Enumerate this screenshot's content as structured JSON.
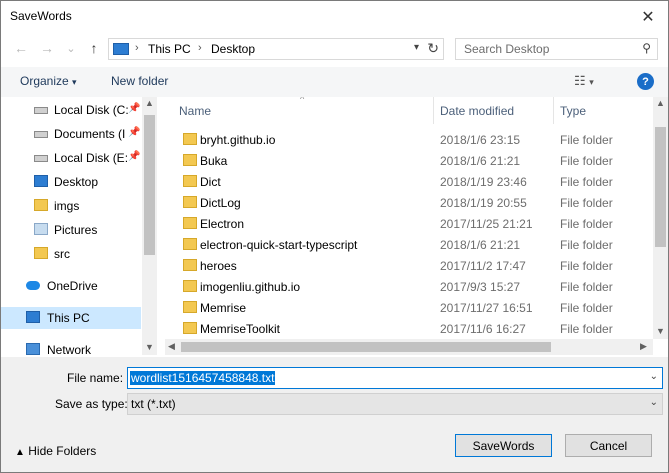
{
  "window": {
    "title": "SaveWords",
    "close_glyph": "✕"
  },
  "nav": {
    "back_glyph": "←",
    "forward_glyph": "→",
    "recent_glyph": "⌄",
    "up_glyph": "↑",
    "breadcrumb": [
      "This PC",
      "Desktop"
    ],
    "search_placeholder": "Search Desktop"
  },
  "toolbar": {
    "organize": "Organize",
    "new_folder": "New folder",
    "help": "?"
  },
  "sidebar": {
    "items": [
      {
        "label": "Local Disk (C:",
        "icon": "disk-icon",
        "pinned": true
      },
      {
        "label": "Documents (I",
        "icon": "disk-icon",
        "pinned": true
      },
      {
        "label": "Local Disk (E:",
        "icon": "disk-icon",
        "pinned": true
      },
      {
        "label": "Desktop",
        "icon": "desktop-icon",
        "pinned": false
      },
      {
        "label": "imgs",
        "icon": "folder-icon",
        "pinned": false
      },
      {
        "label": "Pictures",
        "icon": "pictures-icon",
        "pinned": false
      },
      {
        "label": "src",
        "icon": "folder-icon",
        "pinned": false
      }
    ],
    "onedrive": "OneDrive",
    "this_pc": "This PC",
    "network": "Network"
  },
  "columns": {
    "name": "Name",
    "date": "Date modified",
    "type": "Type"
  },
  "files": [
    {
      "name": "bryht.github.io",
      "date": "2018/1/6 23:15",
      "type": "File folder"
    },
    {
      "name": "Buka",
      "date": "2018/1/6 21:21",
      "type": "File folder"
    },
    {
      "name": "Dict",
      "date": "2018/1/19 23:46",
      "type": "File folder"
    },
    {
      "name": "DictLog",
      "date": "2018/1/19 20:55",
      "type": "File folder"
    },
    {
      "name": "Electron",
      "date": "2017/11/25 21:21",
      "type": "File folder"
    },
    {
      "name": "electron-quick-start-typescript",
      "date": "2018/1/6 21:21",
      "type": "File folder"
    },
    {
      "name": "heroes",
      "date": "2017/11/2 17:47",
      "type": "File folder"
    },
    {
      "name": "imogenliu.github.io",
      "date": "2017/9/3 15:27",
      "type": "File folder"
    },
    {
      "name": "Memrise",
      "date": "2017/11/27 16:51",
      "type": "File folder"
    },
    {
      "name": "MemriseToolkit",
      "date": "2017/11/6 16:27",
      "type": "File folder"
    }
  ],
  "form": {
    "file_name_label": "File name:",
    "file_name_value": "wordlist1516457458848.txt",
    "save_type_label": "Save as type:",
    "save_type_value": "txt (*.txt)"
  },
  "footer": {
    "hide_folders": "Hide Folders",
    "save_button": "SaveWords",
    "cancel_button": "Cancel"
  },
  "colors": {
    "accent": "#0078d7",
    "selection": "#cce8ff",
    "folder": "#f3c851"
  }
}
